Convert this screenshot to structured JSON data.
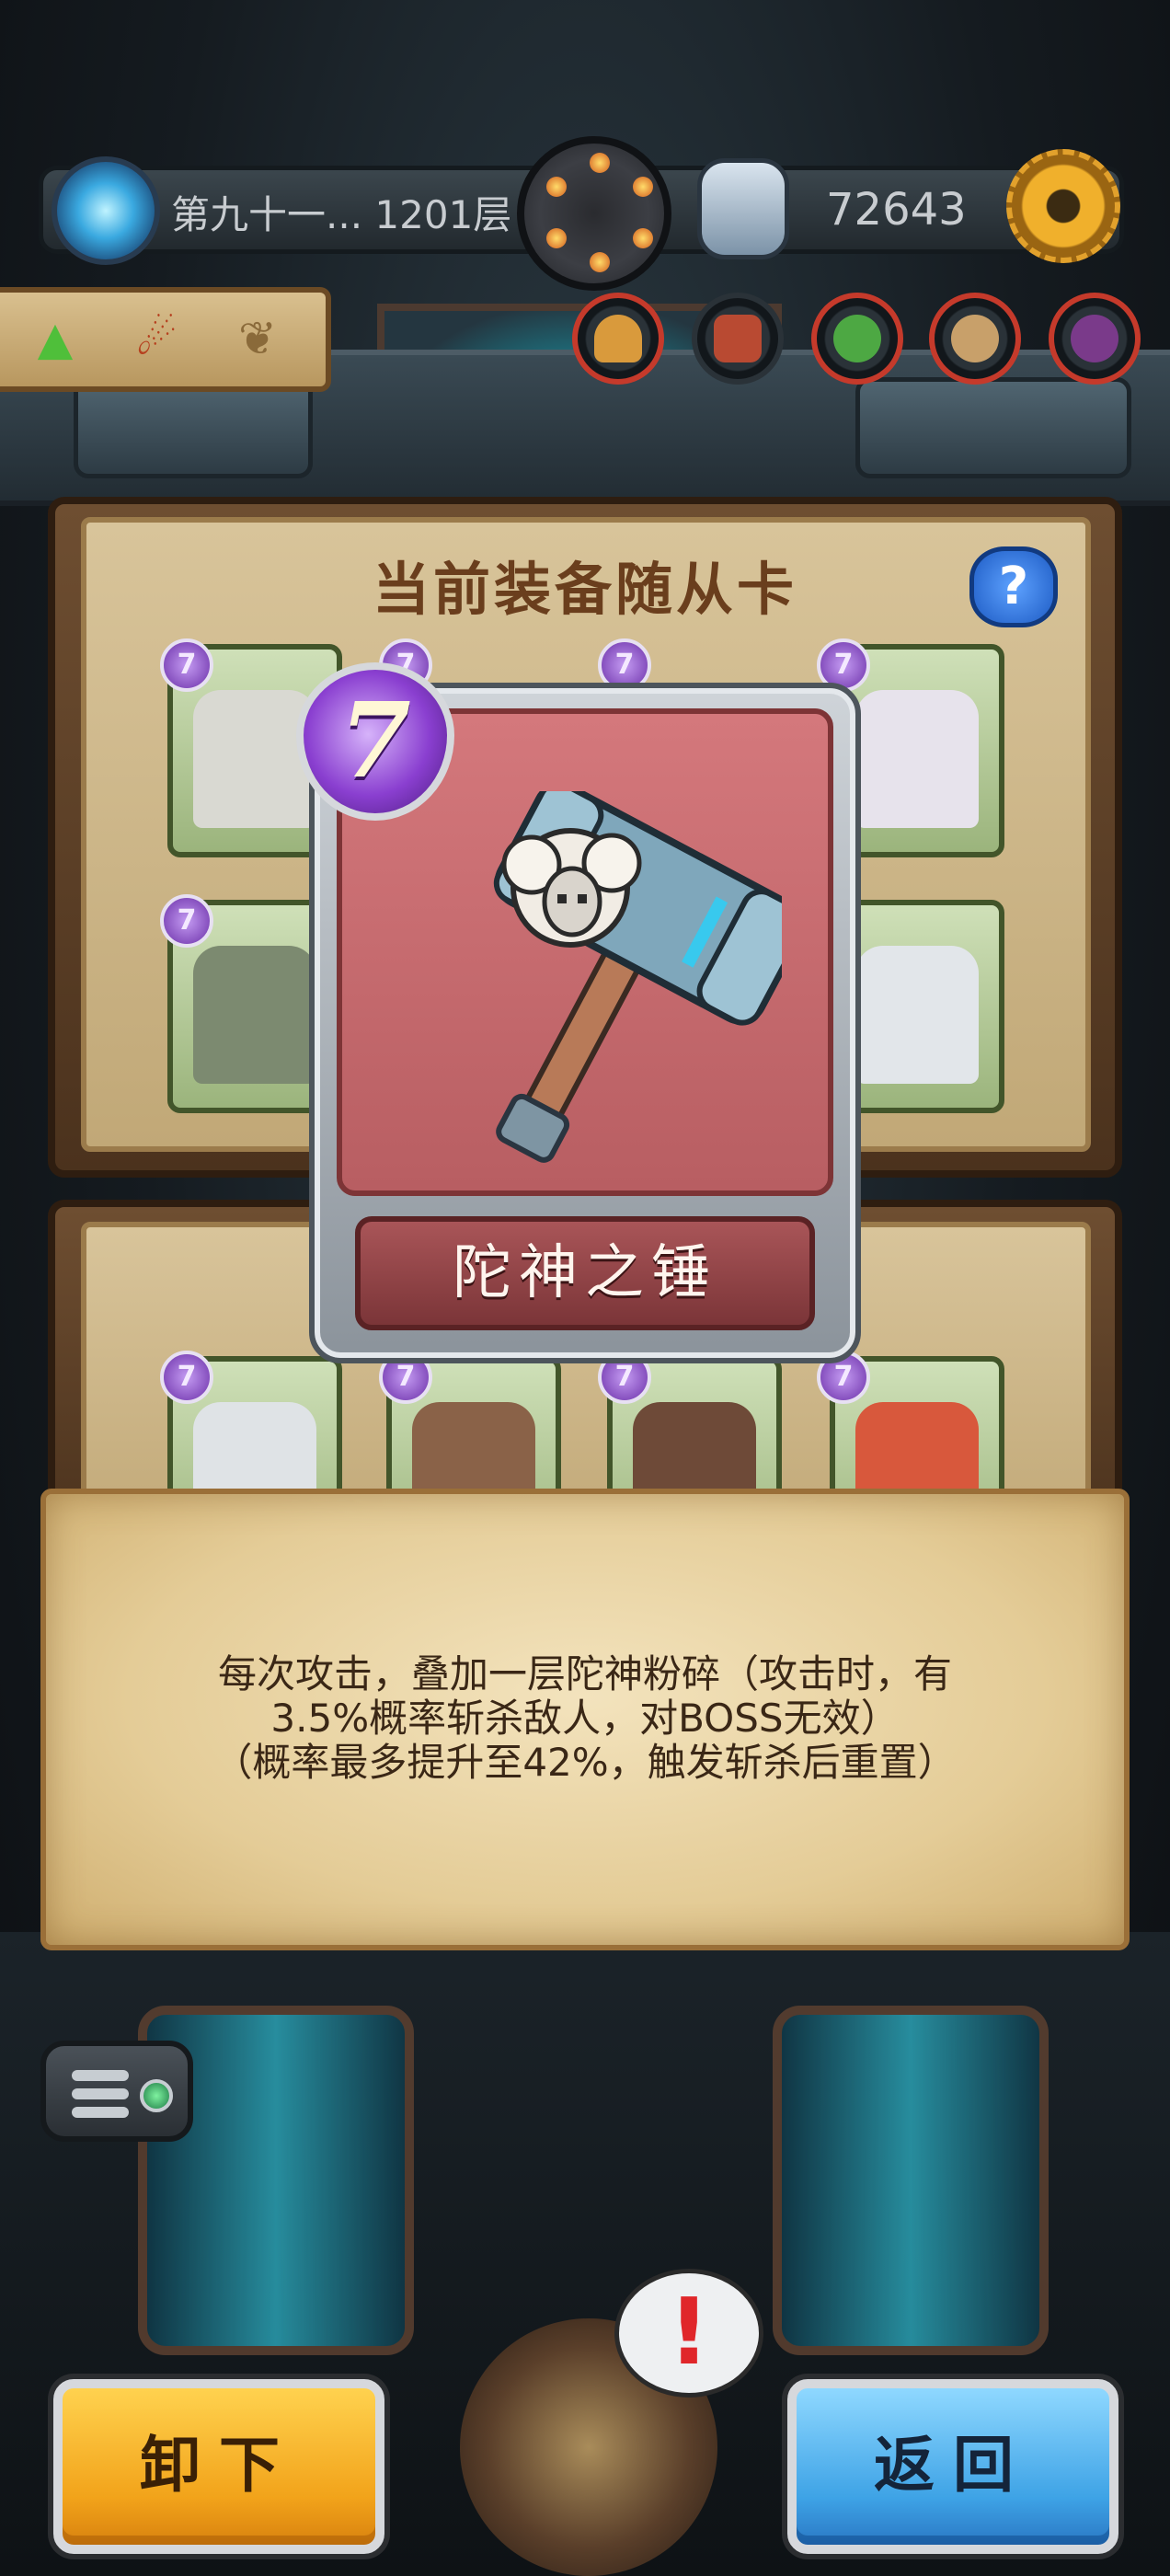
{
  "hud": {
    "floor_label": "第九十一... 1201层",
    "currency_value": "72643"
  },
  "left_mini_buttons": [
    "up-arrow-icon",
    "dragon-icon",
    "wings-icon"
  ],
  "top_round_buttons": [
    "burger-icon",
    "brick-icon",
    "goblin-icon",
    "beast-icon",
    "demon-icon"
  ],
  "equipped_panel": {
    "title": "当前装备随从卡",
    "help_label": "?",
    "slot_level": "7",
    "slots_row1": [
      "sage-statue",
      "hidden",
      "hidden",
      "girl-figure"
    ],
    "slots_row2": [
      "tortoise",
      "hidden",
      "hidden",
      "hut"
    ],
    "slots_row3": [
      "dog",
      "mammoth",
      "boar",
      "red-hood-girl"
    ]
  },
  "featured_card": {
    "level": "7",
    "name": "陀神之锤",
    "art_icon": "sheep-hammer-icon"
  },
  "description": {
    "line1": "每次攻击，叠加一层陀神粉碎（攻击时，有",
    "line2": "3.5%概率斩杀敌人，对BOSS无效）",
    "line3": "（概率最多提升至42%，触发斩杀后重置）"
  },
  "buttons": {
    "unequip": "卸下",
    "back": "返回"
  },
  "colors": {
    "unequip_button": "#f2a31a",
    "back_button": "#3ea3e6",
    "card_face": "#c8696d",
    "level_badge": "#8a3fd0",
    "parchment": "#e4cc97"
  }
}
